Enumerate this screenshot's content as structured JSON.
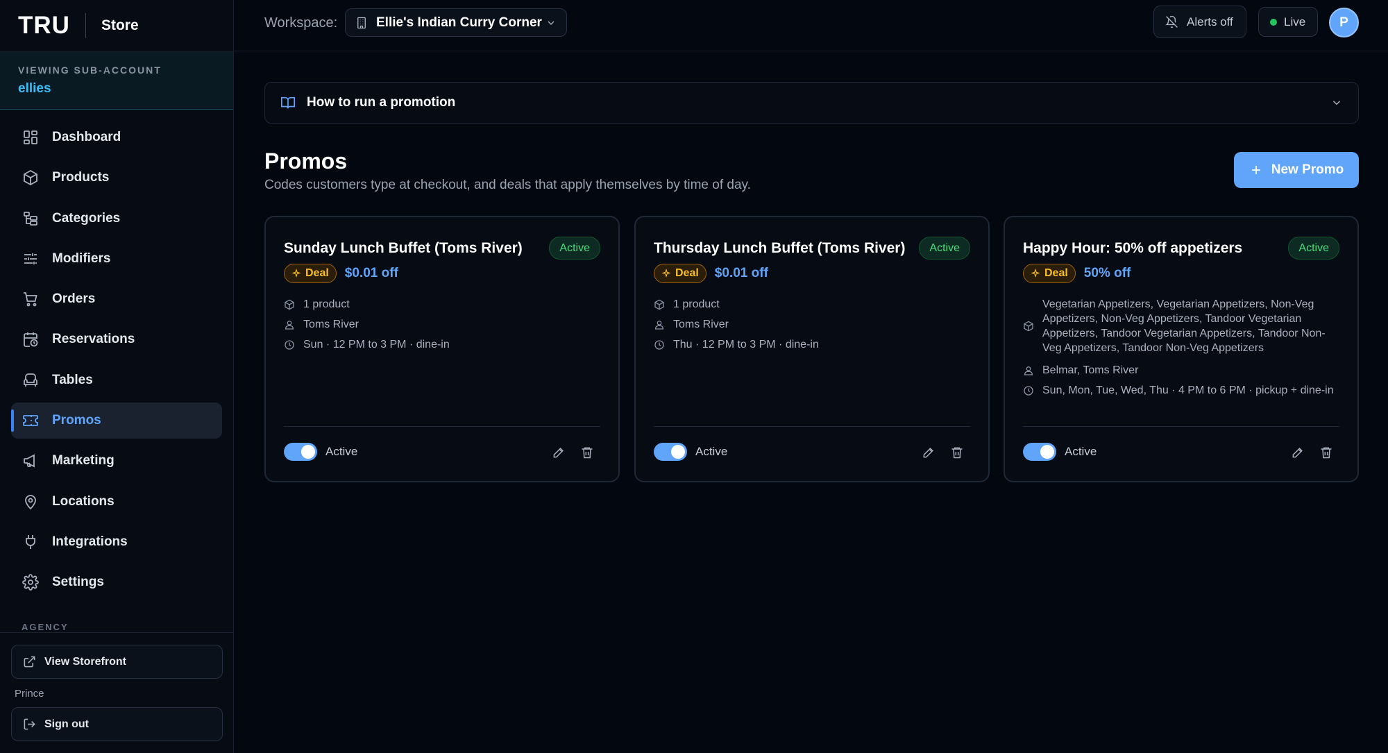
{
  "brand": {
    "logo": "TRU",
    "section": "Store"
  },
  "subaccount": {
    "label": "VIEWING SUB-ACCOUNT",
    "name": "ellies"
  },
  "nav": [
    {
      "label": "Dashboard",
      "icon": "dashboard-icon"
    },
    {
      "label": "Products",
      "icon": "box-icon"
    },
    {
      "label": "Categories",
      "icon": "categories-icon"
    },
    {
      "label": "Modifiers",
      "icon": "sliders-icon"
    },
    {
      "label": "Orders",
      "icon": "cart-icon"
    },
    {
      "label": "Reservations",
      "icon": "calendar-clock-icon"
    },
    {
      "label": "Tables",
      "icon": "armchair-icon"
    },
    {
      "label": "Promos",
      "icon": "ticket-icon",
      "active": true
    },
    {
      "label": "Marketing",
      "icon": "megaphone-icon"
    },
    {
      "label": "Locations",
      "icon": "map-pin-icon"
    },
    {
      "label": "Integrations",
      "icon": "plug-icon"
    },
    {
      "label": "Settings",
      "icon": "gear-icon"
    }
  ],
  "agency": {
    "label": "AGENCY",
    "view_storefront": "View Storefront",
    "user_name": "Prince",
    "sign_out": "Sign out"
  },
  "topbar": {
    "workspace_label": "Workspace:",
    "workspace_name": "Ellie's Indian Curry Corner",
    "alerts_label": "Alerts off",
    "live_label": "Live",
    "avatar_initial": "P"
  },
  "howto": {
    "title": "How to run a promotion"
  },
  "header": {
    "title": "Promos",
    "subtitle": "Codes customers type at checkout, and deals that apply themselves by time of day.",
    "new_promo_label": "New Promo"
  },
  "promos": [
    {
      "title": "Sunday Lunch Buffet (Toms River)",
      "status": "Active",
      "type": "Deal",
      "value": "$0.01 off",
      "products": "1 product",
      "locations": "Toms River",
      "schedule": "Sun · 12 PM to 3 PM · dine-in",
      "toggle_label": "Active"
    },
    {
      "title": "Thursday Lunch Buffet (Toms River)",
      "status": "Active",
      "type": "Deal",
      "value": "$0.01 off",
      "products": "1 product",
      "locations": "Toms River",
      "schedule": "Thu · 12 PM to 3 PM · dine-in",
      "toggle_label": "Active"
    },
    {
      "title": "Happy Hour: 50% off appetizers",
      "status": "Active",
      "type": "Deal",
      "value": "50% off",
      "products": "Vegetarian Appetizers, Vegetarian Appetizers, Non-Veg Appetizers, Non-Veg Appetizers, Tandoor Vegetarian Appetizers, Tandoor Vegetarian Appetizers, Tandoor Non-Veg Appetizers, Tandoor Non-Veg Appetizers",
      "locations": "Belmar, Toms River",
      "schedule": "Sun, Mon, Tue, Wed, Thu · 4 PM to 6 PM · pickup + dine-in",
      "toggle_label": "Active"
    }
  ],
  "colors": {
    "accent": "#60a5fa",
    "background": "#03070f",
    "active_green": "#4ade80",
    "deal_amber": "#fbbf24",
    "subaccount_name": "#38bdf8"
  }
}
